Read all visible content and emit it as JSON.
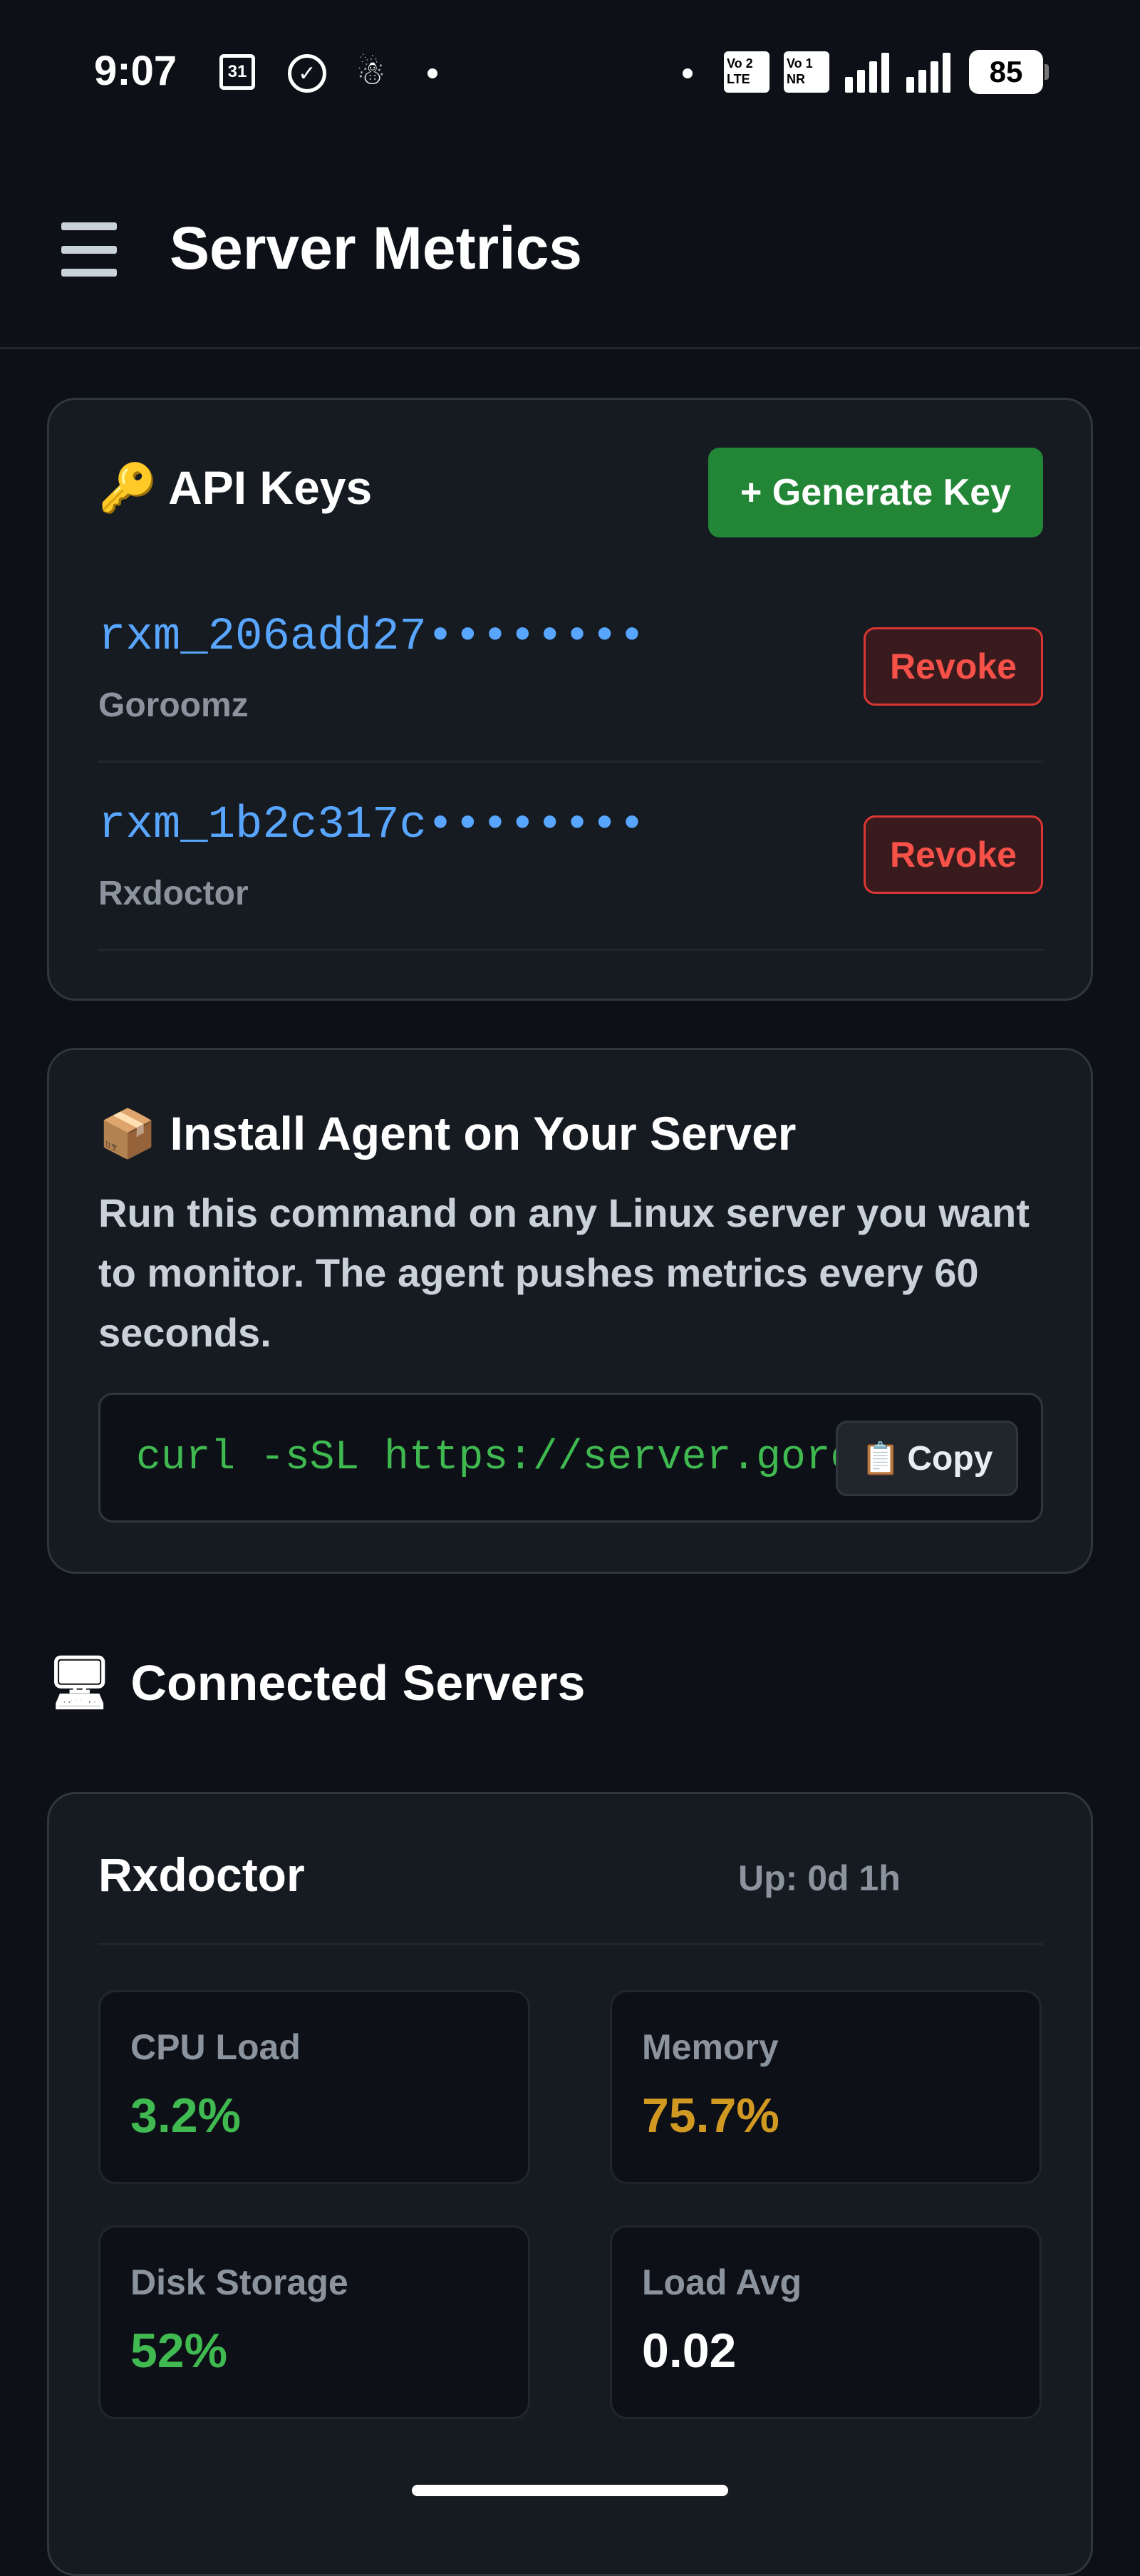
{
  "status_bar": {
    "time": "9:07",
    "calendar_day": "31",
    "battery": "85",
    "sim1": "Vo 2\nLTE",
    "sim2": "Vo 1\nNR"
  },
  "header": {
    "title": "Server Metrics"
  },
  "api_keys": {
    "title": "🔑 API Keys",
    "generate_label": "+ Generate Key",
    "revoke_label": "Revoke",
    "keys": [
      {
        "id": "rxm_206add27••••••••",
        "name": "Goroomz"
      },
      {
        "id": "rxm_1b2c317c••••••••",
        "name": "Rxdoctor"
      }
    ]
  },
  "install": {
    "title": "📦 Install Agent on Your Server",
    "description": "Run this command on any Linux server you want to monitor. The agent pushes metrics every 60 seconds.",
    "command": "curl -sSL https://server.goro",
    "copy_label": "Copy"
  },
  "connected": {
    "title": "Connected Servers",
    "servers": [
      {
        "name": "Rxdoctor",
        "uptime": "Up: 0d 1h",
        "metrics": [
          {
            "label": "CPU Load",
            "value": "3.2%",
            "color": "#3fb950"
          },
          {
            "label": "Memory",
            "value": "75.7%",
            "color": "#d29922"
          },
          {
            "label": "Disk Storage",
            "value": "52%",
            "color": "#3fb950"
          },
          {
            "label": "Load Avg",
            "value": "0.02",
            "color": "#ffffff"
          }
        ]
      }
    ]
  }
}
